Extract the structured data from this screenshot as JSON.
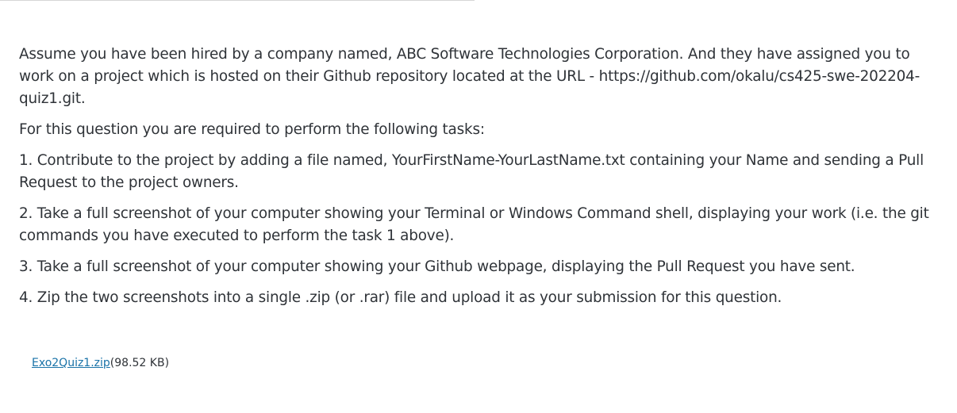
{
  "question": {
    "intro": "Assume you have been hired by a company named, ABC Software Technologies Corporation. And they have assigned you to work on a project which is hosted on their Github repository located at the URL - https://github.com/okalu/cs425-swe-202204-quiz1.git.",
    "lead": "For this question you are required to perform the following tasks:",
    "tasks": [
      "1. Contribute to the project by adding a file named, YourFirstName-YourLastName.txt containing your Name and sending a Pull Request to the project owners.",
      "2. Take a full screenshot of your computer showing your Terminal or Windows Command shell, displaying your work (i.e. the git commands you have executed to perform the task 1 above).",
      "3. Take a full screenshot of your computer showing your Github webpage, displaying the Pull Request you have sent.",
      "4. Zip the two screenshots into a single .zip (or .rar) file and upload it as your submission for this question."
    ]
  },
  "attachment": {
    "file_name": "Exo2Quiz1.zip",
    "file_size": "(98.52 KB)",
    "link_color": "#1a73a8"
  }
}
